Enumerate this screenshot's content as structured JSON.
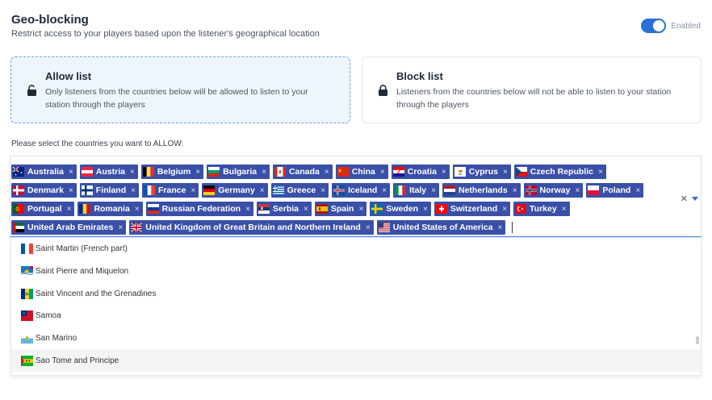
{
  "header": {
    "title": "Geo-blocking",
    "subtitle": "Restrict access to your players based upon the listener's geographical location",
    "toggle_label": "Enabled",
    "toggle_on": true
  },
  "modes": {
    "allow": {
      "title": "Allow list",
      "desc": "Only listeners from the countries below will be allowed to listen to your station through the players",
      "selected": true
    },
    "block": {
      "title": "Block list",
      "desc": "Listeners from the countries below will not be able to listen to your station through the players",
      "selected": false
    }
  },
  "prompt": "Please select the countries you want to ALLOW:",
  "selected_countries": [
    {
      "label": "Australia",
      "flag": "au"
    },
    {
      "label": "Austria",
      "flag": "at"
    },
    {
      "label": "Belgium",
      "flag": "be"
    },
    {
      "label": "Bulgaria",
      "flag": "bg"
    },
    {
      "label": "Canada",
      "flag": "ca"
    },
    {
      "label": "China",
      "flag": "cn"
    },
    {
      "label": "Croatia",
      "flag": "hr"
    },
    {
      "label": "Cyprus",
      "flag": "cy"
    },
    {
      "label": "Czech Republic",
      "flag": "cz"
    },
    {
      "label": "Denmark",
      "flag": "dk"
    },
    {
      "label": "Finland",
      "flag": "fi"
    },
    {
      "label": "France",
      "flag": "fr"
    },
    {
      "label": "Germany",
      "flag": "de"
    },
    {
      "label": "Greece",
      "flag": "gr"
    },
    {
      "label": "Iceland",
      "flag": "is"
    },
    {
      "label": "Italy",
      "flag": "it"
    },
    {
      "label": "Netherlands",
      "flag": "nl"
    },
    {
      "label": "Norway",
      "flag": "no"
    },
    {
      "label": "Poland",
      "flag": "pl"
    },
    {
      "label": "Portugal",
      "flag": "pt"
    },
    {
      "label": "Romania",
      "flag": "ro"
    },
    {
      "label": "Russian Federation",
      "flag": "ru"
    },
    {
      "label": "Serbia",
      "flag": "rs"
    },
    {
      "label": "Spain",
      "flag": "es"
    },
    {
      "label": "Sweden",
      "flag": "se"
    },
    {
      "label": "Switzerland",
      "flag": "ch"
    },
    {
      "label": "Turkey",
      "flag": "tr"
    },
    {
      "label": "United Arab Emirates",
      "flag": "ae"
    },
    {
      "label": "United Kingdom of Great Britain and Northern Ireland",
      "flag": "gb"
    },
    {
      "label": "United States of America",
      "flag": "us"
    }
  ],
  "tag_remove_glyph": "×",
  "clear_glyph": "✕",
  "dropdown_options": [
    {
      "label": "Saint Martin (French part)",
      "flag": "fr",
      "hover": false
    },
    {
      "label": "Saint Pierre and Miquelon",
      "flag": "pm",
      "hover": false
    },
    {
      "label": "Saint Vincent and the Grenadines",
      "flag": "vc",
      "hover": false
    },
    {
      "label": "Samoa",
      "flag": "ws",
      "hover": false
    },
    {
      "label": "San Marino",
      "flag": "sm",
      "hover": false
    },
    {
      "label": "Sao Tome and Principe",
      "flag": "st",
      "hover": true
    }
  ],
  "colors": {
    "accent": "#2b6fd6",
    "tag_bg": "#3a50a8",
    "allow_bg": "#eef5fd"
  }
}
